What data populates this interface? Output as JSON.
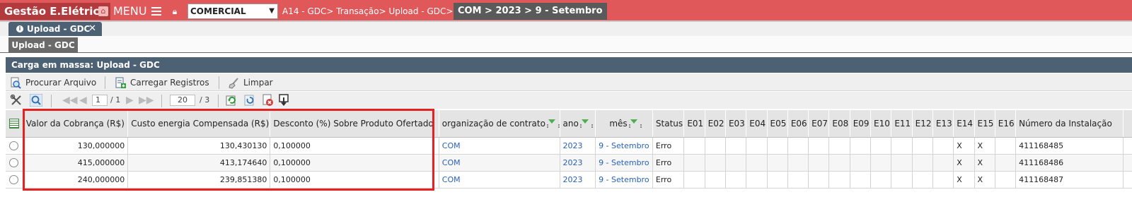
{
  "topbar": {
    "brand": "Gestão E.Elétrica",
    "menu_label": "MENU",
    "module_selected": "COMERCIAL",
    "breadcrumb": "A14 - GDC> Transação> Upload - GDC>",
    "context": "COM > 2023 > 9 - Setembro",
    "colors": {
      "bar": "#e0585a",
      "context": "#5a5a5a"
    }
  },
  "tabs": [
    {
      "label": "Upload - GDC"
    }
  ],
  "subtabs": [
    {
      "label": "Upload - GDC"
    }
  ],
  "panel": {
    "title": "Carga em massa: Upload - GDC",
    "actions": {
      "browse": "Procurar Arquivo",
      "load": "Carregar Registros",
      "clear": "Limpar"
    }
  },
  "pager": {
    "page": "1",
    "page_total": "/ 1",
    "page_size": "20",
    "count": "/ 3"
  },
  "grid": {
    "columns": {
      "valor": "Valor da Cobrança (R$)",
      "custo": "Custo energia Compensada (R$)",
      "desconto": "Desconto (%) Sobre Produto Ofertado",
      "org": "organização de contrato",
      "ano": "ano",
      "mes": "mês",
      "status": "Status",
      "e01": "E01",
      "e02": "E02",
      "e03": "E03",
      "e04": "E04",
      "e05": "E05",
      "e06": "E06",
      "e07": "E07",
      "e08": "E08",
      "e09": "E09",
      "e10": "E10",
      "e11": "E11",
      "e12": "E12",
      "e13": "E13",
      "e14": "E14",
      "e15": "E15",
      "e16": "E16",
      "instalacao": "Número da Instalação"
    },
    "rows": [
      {
        "valor": "130,000000",
        "custo": "130,430130",
        "desconto": "0,100000",
        "org": "COM",
        "ano": "2023",
        "mes": "9 - Setembro",
        "status": "Erro",
        "e14": "X",
        "e15": "X",
        "instalacao": "411168485"
      },
      {
        "valor": "415,000000",
        "custo": "413,174640",
        "desconto": "0,100000",
        "org": "COM",
        "ano": "2023",
        "mes": "9 - Setembro",
        "status": "Erro",
        "e14": "X",
        "e15": "X",
        "instalacao": "411168486"
      },
      {
        "valor": "240,000000",
        "custo": "239,851380",
        "desconto": "0,100000",
        "org": "COM",
        "ano": "2023",
        "mes": "9 - Setembro",
        "status": "Erro",
        "e14": "X",
        "e15": "X",
        "instalacao": "411168487"
      }
    ]
  }
}
